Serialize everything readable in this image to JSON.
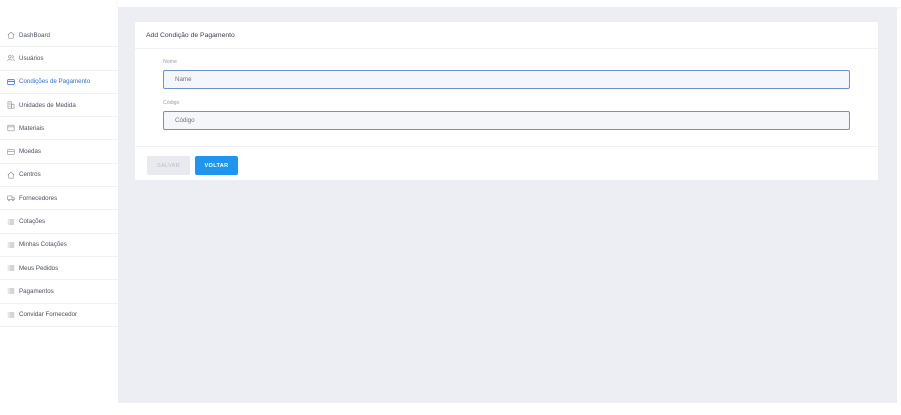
{
  "sidebar": {
    "items": [
      {
        "label": "DashBoard",
        "icon": "home-icon",
        "active": false
      },
      {
        "label": "Usuários",
        "icon": "users-icon",
        "active": false
      },
      {
        "label": "Condições de Pagamento",
        "icon": "card-icon",
        "active": true
      },
      {
        "label": "Unidades de Medida",
        "icon": "building-icon",
        "active": false
      },
      {
        "label": "Materiais",
        "icon": "box-icon",
        "active": false
      },
      {
        "label": "Moedas",
        "icon": "card-icon",
        "active": false
      },
      {
        "label": "Centros",
        "icon": "home-icon",
        "active": false
      },
      {
        "label": "Fornecedores",
        "icon": "truck-icon",
        "active": false
      },
      {
        "label": "Cotações",
        "icon": "list-icon",
        "active": false
      },
      {
        "label": "Minhas Cotações",
        "icon": "list-icon",
        "active": false
      },
      {
        "label": "Meus Pedidos",
        "icon": "list-icon",
        "active": false
      },
      {
        "label": "Pagamentos",
        "icon": "list-icon",
        "active": false
      },
      {
        "label": "Convidar Fornecedor",
        "icon": "list-icon",
        "active": false
      }
    ],
    "active_color": "#2f6fe0"
  },
  "card": {
    "title": "Add Condição de Pagamento",
    "fields": {
      "name": {
        "label": "Nome",
        "placeholder": "Name",
        "value": ""
      },
      "code": {
        "label": "Código",
        "placeholder": "Código",
        "value": ""
      }
    },
    "buttons": {
      "save_label": "SALVAR",
      "back_label": "VOLTAR"
    }
  },
  "colors": {
    "primary_button": "#1e96f0",
    "disabled_button": "#e8eaef",
    "background": "#edeef3",
    "input_border": "#6d92cf"
  }
}
